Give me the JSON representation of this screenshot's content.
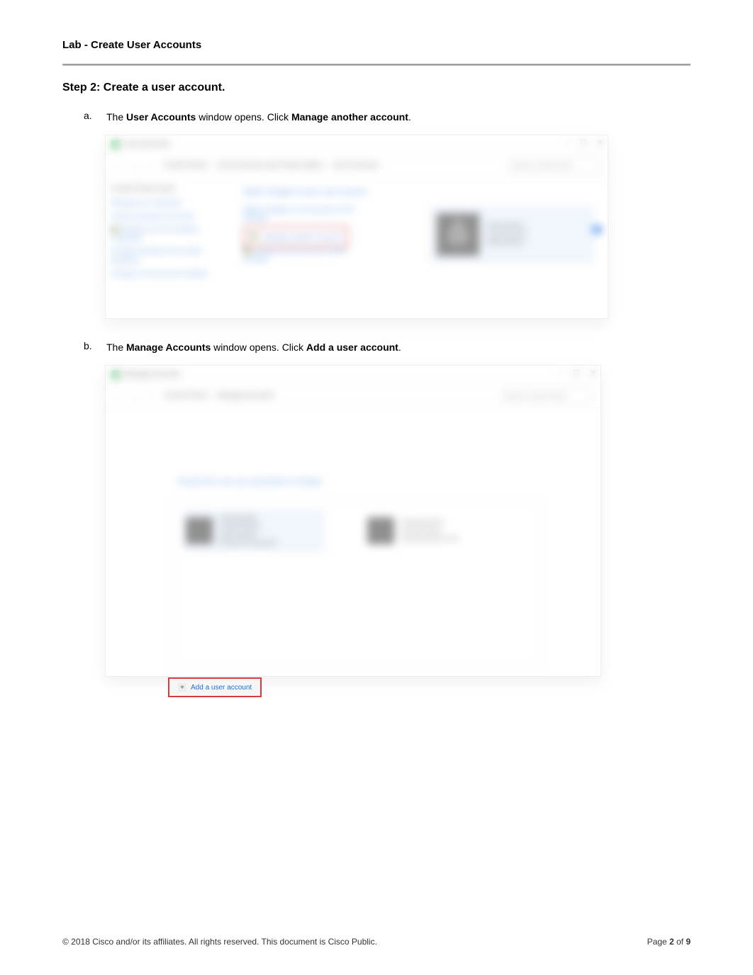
{
  "header": {
    "lab_title": "Lab - Create User Accounts"
  },
  "step": {
    "heading": "Step 2:   Create a user account."
  },
  "item_a": {
    "letter": "a.",
    "text_1": "The ",
    "bold_1": "User Accounts",
    "text_2": " window opens. Click ",
    "bold_2": "Manage another account",
    "text_3": "."
  },
  "item_b": {
    "letter": "b.",
    "text_1": "The ",
    "bold_1": "Manage Accounts",
    "text_2": " window opens. Click ",
    "bold_2": "Add a user account",
    "text_3": "."
  },
  "screenshot1": {
    "window_title": "User Accounts",
    "breadcrumb_1": "Control Panel",
    "breadcrumb_2": "User Accounts and Family Safety",
    "breadcrumb_3": "User Accounts",
    "search_placeholder": "Search Control Panel",
    "sidebar_heading": "Control Panel Home",
    "side_link_1": "Manage your credentials",
    "side_link_2": "Create a password reset disk",
    "side_link_3": "Manage your file encryption certificates",
    "side_link_4": "Configure advanced user profile properties",
    "side_link_5": "Change my environment variables",
    "main_heading": "Make changes to your user account",
    "link_1": "Make changes to my account in PC settings",
    "link_highlighted": "Manage another account",
    "link_2": "Change User Account Control settings",
    "account_name": "Administrator",
    "account_type": "Local Account",
    "account_role": "Administrator"
  },
  "screenshot2": {
    "window_title": "Manage Accounts",
    "breadcrumb_1": "Control Panel",
    "breadcrumb_2": "Manage Accounts",
    "search_placeholder": "Search Control Panel",
    "main_heading": "Choose the user you would like to change",
    "tile1_name": "Administrator",
    "tile1_type": "Local Account",
    "tile1_role": "Administrator",
    "tile1_protected": "Password protected",
    "tile2_name": "Guest Account",
    "tile2_type": "Local Account",
    "tile2_status": "Guest account is off",
    "add_link": "Add a user account"
  },
  "footer": {
    "copyright": "© 2018 Cisco and/or its affiliates. All rights reserved. This document is Cisco Public.",
    "page_label": "Page ",
    "page_num": "2",
    "page_of": " of ",
    "page_total": "9"
  }
}
